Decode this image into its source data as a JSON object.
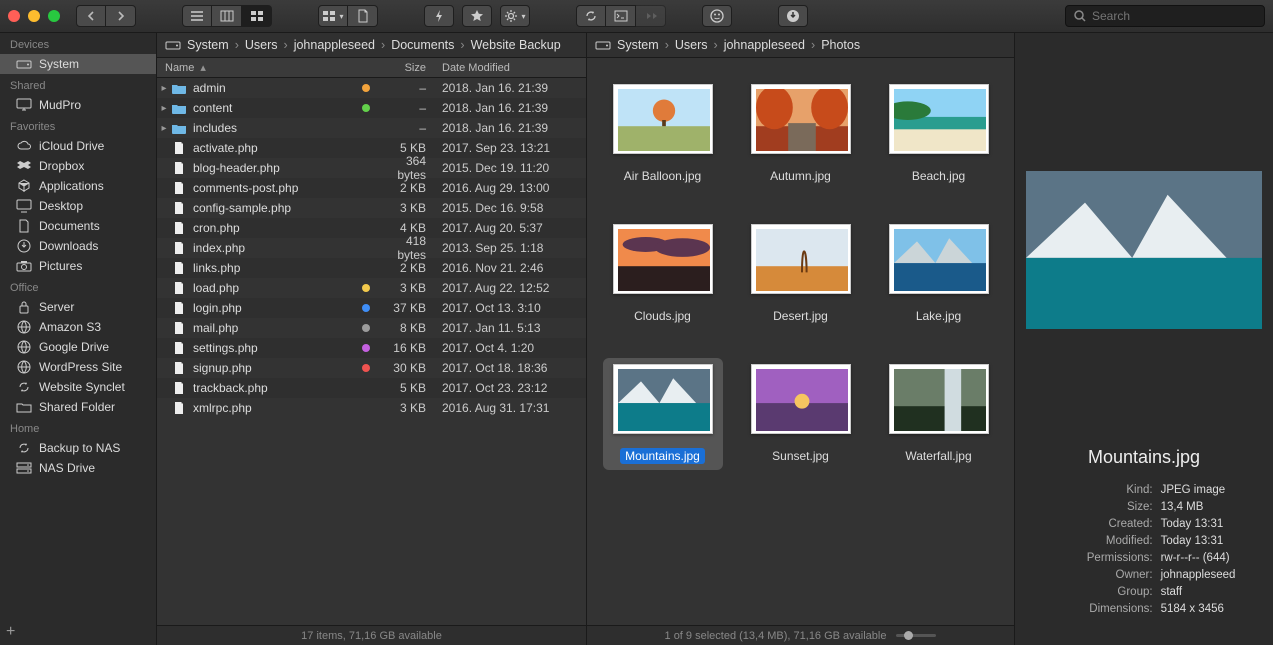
{
  "toolbar": {
    "search_placeholder": "Search"
  },
  "sidebar": {
    "sections": [
      {
        "title": "Devices",
        "items": [
          {
            "label": "System",
            "icon": "drive",
            "selected": true
          }
        ]
      },
      {
        "title": "Shared",
        "items": [
          {
            "label": "MudPro",
            "icon": "display"
          }
        ]
      },
      {
        "title": "Favorites",
        "items": [
          {
            "label": "iCloud Drive",
            "icon": "cloud"
          },
          {
            "label": "Dropbox",
            "icon": "dropbox"
          },
          {
            "label": "Applications",
            "icon": "apps"
          },
          {
            "label": "Desktop",
            "icon": "desktop"
          },
          {
            "label": "Documents",
            "icon": "doc"
          },
          {
            "label": "Downloads",
            "icon": "download"
          },
          {
            "label": "Pictures",
            "icon": "camera"
          }
        ]
      },
      {
        "title": "Office",
        "items": [
          {
            "label": "Server",
            "icon": "lock"
          },
          {
            "label": "Amazon S3",
            "icon": "globe"
          },
          {
            "label": "Google Drive",
            "icon": "globe"
          },
          {
            "label": "WordPress Site",
            "icon": "globe"
          },
          {
            "label": "Website Synclet",
            "icon": "sync"
          },
          {
            "label": "Shared Folder",
            "icon": "folder"
          }
        ]
      },
      {
        "title": "Home",
        "items": [
          {
            "label": "Backup to NAS",
            "icon": "sync"
          },
          {
            "label": "NAS Drive",
            "icon": "nas"
          }
        ]
      }
    ]
  },
  "list": {
    "breadcrumb": [
      "System",
      "Users",
      "johnappleseed",
      "Documents",
      "Website Backup"
    ],
    "columns": {
      "name": "Name",
      "size": "Size",
      "date": "Date Modified"
    },
    "rows": [
      {
        "folder": true,
        "name": "admin",
        "tag": "#f2a33c",
        "size": "–",
        "date": "2018. Jan 16. 21:39"
      },
      {
        "folder": true,
        "name": "content",
        "tag": "#63d14b",
        "size": "–",
        "date": "2018. Jan 16. 21:39"
      },
      {
        "folder": true,
        "name": "includes",
        "tag": null,
        "size": "–",
        "date": "2018. Jan 16. 21:39"
      },
      {
        "folder": false,
        "name": "activate.php",
        "tag": null,
        "size": "5 KB",
        "date": "2017. Sep 23. 13:21"
      },
      {
        "folder": false,
        "name": "blog-header.php",
        "tag": null,
        "size": "364 bytes",
        "date": "2015. Dec 19. 11:20"
      },
      {
        "folder": false,
        "name": "comments-post.php",
        "tag": null,
        "size": "2 KB",
        "date": "2016. Aug 29. 13:00"
      },
      {
        "folder": false,
        "name": "config-sample.php",
        "tag": null,
        "size": "3 KB",
        "date": "2015. Dec 16. 9:58"
      },
      {
        "folder": false,
        "name": "cron.php",
        "tag": null,
        "size": "4 KB",
        "date": "2017. Aug 20. 5:37"
      },
      {
        "folder": false,
        "name": "index.php",
        "tag": null,
        "size": "418 bytes",
        "date": "2013. Sep 25. 1:18"
      },
      {
        "folder": false,
        "name": "links.php",
        "tag": null,
        "size": "2 KB",
        "date": "2016. Nov 21. 2:46"
      },
      {
        "folder": false,
        "name": "load.php",
        "tag": "#f2c94c",
        "size": "3 KB",
        "date": "2017. Aug 22. 12:52"
      },
      {
        "folder": false,
        "name": "login.php",
        "tag": "#3f8ef7",
        "size": "37 KB",
        "date": "2017. Oct 13. 3:10"
      },
      {
        "folder": false,
        "name": "mail.php",
        "tag": "#9c9c9c",
        "size": "8 KB",
        "date": "2017. Jan 11. 5:13"
      },
      {
        "folder": false,
        "name": "settings.php",
        "tag": "#c461e0",
        "size": "16 KB",
        "date": "2017. Oct 4. 1:20"
      },
      {
        "folder": false,
        "name": "signup.php",
        "tag": "#ef5350",
        "size": "30 KB",
        "date": "2017. Oct 18. 18:36"
      },
      {
        "folder": false,
        "name": "trackback.php",
        "tag": null,
        "size": "5 KB",
        "date": "2017. Oct 23. 23:12"
      },
      {
        "folder": false,
        "name": "xmlrpc.php",
        "tag": null,
        "size": "3 KB",
        "date": "2016. Aug 31. 17:31"
      }
    ],
    "status": "17 items, 71,16 GB available"
  },
  "grid": {
    "breadcrumb": [
      "System",
      "Users",
      "johnappleseed",
      "Photos"
    ],
    "items": [
      {
        "name": "Air Balloon.jpg",
        "thumb": "balloon"
      },
      {
        "name": "Autumn.jpg",
        "thumb": "autumn"
      },
      {
        "name": "Beach.jpg",
        "thumb": "beach"
      },
      {
        "name": "Clouds.jpg",
        "thumb": "clouds"
      },
      {
        "name": "Desert.jpg",
        "thumb": "desert"
      },
      {
        "name": "Lake.jpg",
        "thumb": "lake"
      },
      {
        "name": "Mountains.jpg",
        "thumb": "mountains",
        "selected": true
      },
      {
        "name": "Sunset.jpg",
        "thumb": "sunset"
      },
      {
        "name": "Waterfall.jpg",
        "thumb": "waterfall"
      }
    ],
    "status": "1 of 9 selected (13,4 MB), 71,16 GB available"
  },
  "preview": {
    "title": "Mountains.jpg",
    "meta": [
      {
        "k": "Kind:",
        "v": "JPEG image"
      },
      {
        "k": "Size:",
        "v": "13,4 MB"
      },
      {
        "k": "Created:",
        "v": "Today 13:31"
      },
      {
        "k": "Modified:",
        "v": "Today 13:31"
      },
      {
        "k": "Permissions:",
        "v": "rw-r--r-- (644)"
      },
      {
        "k": "Owner:",
        "v": "johnappleseed"
      },
      {
        "k": "Group:",
        "v": "staff"
      },
      {
        "k": "Dimensions:",
        "v": "5184 x 3456"
      }
    ]
  },
  "thumbs": {
    "balloon": {
      "sky": "#bfe3f7",
      "ground": "#9fb26a",
      "extra": "balloon"
    },
    "autumn": {
      "sky": "#e7a16a",
      "ground": "#a13d1f",
      "trees": "#c74b1b"
    },
    "beach": {
      "sky": "#8fd3f4",
      "ground": "#f0e6c8",
      "sea": "#2a9d8f"
    },
    "clouds": {
      "sky": "#f08a4b",
      "ground": "#2b1e1e",
      "clouds": "#5b3550"
    },
    "desert": {
      "sky": "#dce7ef",
      "ground": "#d68a3a",
      "tree": "#6b3a12"
    },
    "lake": {
      "sky": "#7fc1e8",
      "ground": "#1e6a4c",
      "water": "#1a5a8a"
    },
    "mountains": {
      "sky": "#5b7486",
      "ground": "#2e5a3e",
      "water": "#0d7c8a",
      "snow": "#e8eef1"
    },
    "sunset": {
      "sky": "#a060c0",
      "ground": "#3a2a50",
      "sun": "#f6c560"
    },
    "waterfall": {
      "sky": "#6a7d68",
      "ground": "#203020",
      "water": "#d0dce0"
    }
  }
}
